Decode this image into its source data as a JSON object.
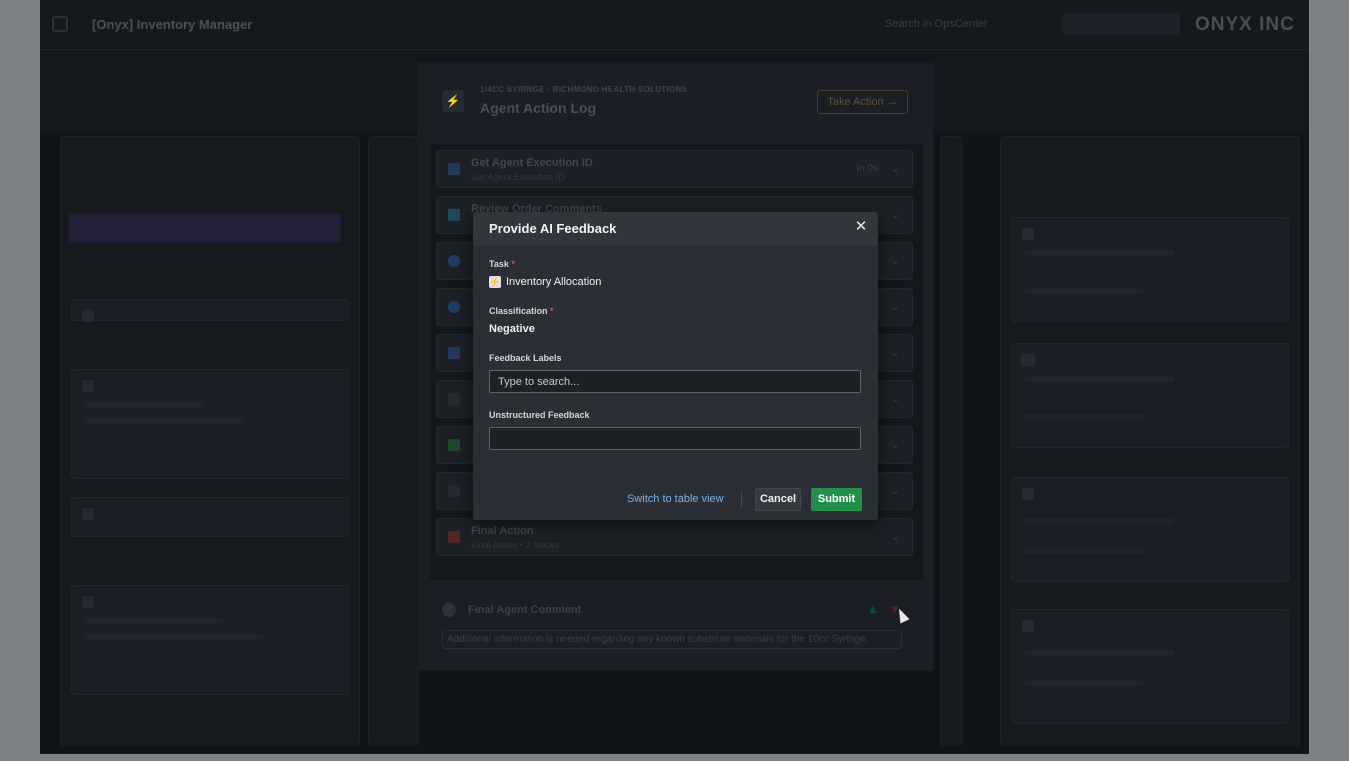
{
  "app": {
    "title": "[Onyx] Inventory Manager",
    "brand": "ONYX INC",
    "search_placeholder": "Search in OpsCenter"
  },
  "panel": {
    "subtitle": "1/4CC SYRINGE - RICHMOND HEALTH SOLUTIONS",
    "title": "Agent Action Log",
    "take_action_label": "Take Action",
    "steps": [
      {
        "title": "Get Agent Execution ID",
        "subtitle": "Get Agent Execution ID",
        "meta": "In 0s"
      },
      {
        "title": "Review Order Comments",
        "subtitle": "",
        "meta": ""
      },
      {
        "title": "",
        "subtitle": "",
        "meta": ""
      },
      {
        "title": "",
        "subtitle": "",
        "meta": ""
      },
      {
        "title": "",
        "subtitle": "",
        "meta": ""
      },
      {
        "title": "",
        "subtitle": "",
        "meta": ""
      },
      {
        "title": "",
        "subtitle": "",
        "meta": ""
      },
      {
        "title": "",
        "subtitle": "",
        "meta": ""
      },
      {
        "title": "Final Action",
        "subtitle": "Final Action • 2 blocks",
        "meta": ""
      }
    ],
    "final_comment_label": "Final Agent Comment",
    "final_comment_text": "Additional information is needed regarding any known substitute materials for the 10cc Syringe."
  },
  "modal": {
    "title": "Provide AI Feedback",
    "task_label": "Task",
    "task_value": "Inventory Allocation",
    "classification_label": "Classification",
    "classification_value": "Negative",
    "feedback_labels_label": "Feedback Labels",
    "feedback_labels_placeholder": "Type to search...",
    "unstructured_label": "Unstructured Feedback",
    "unstructured_value": "",
    "switch_link": "Switch to table view",
    "cancel_label": "Cancel",
    "submit_label": "Submit",
    "required_mark": "*"
  },
  "colors": {
    "submit": "#23904a",
    "link": "#7fb0e6",
    "required": "#d94b4b"
  }
}
